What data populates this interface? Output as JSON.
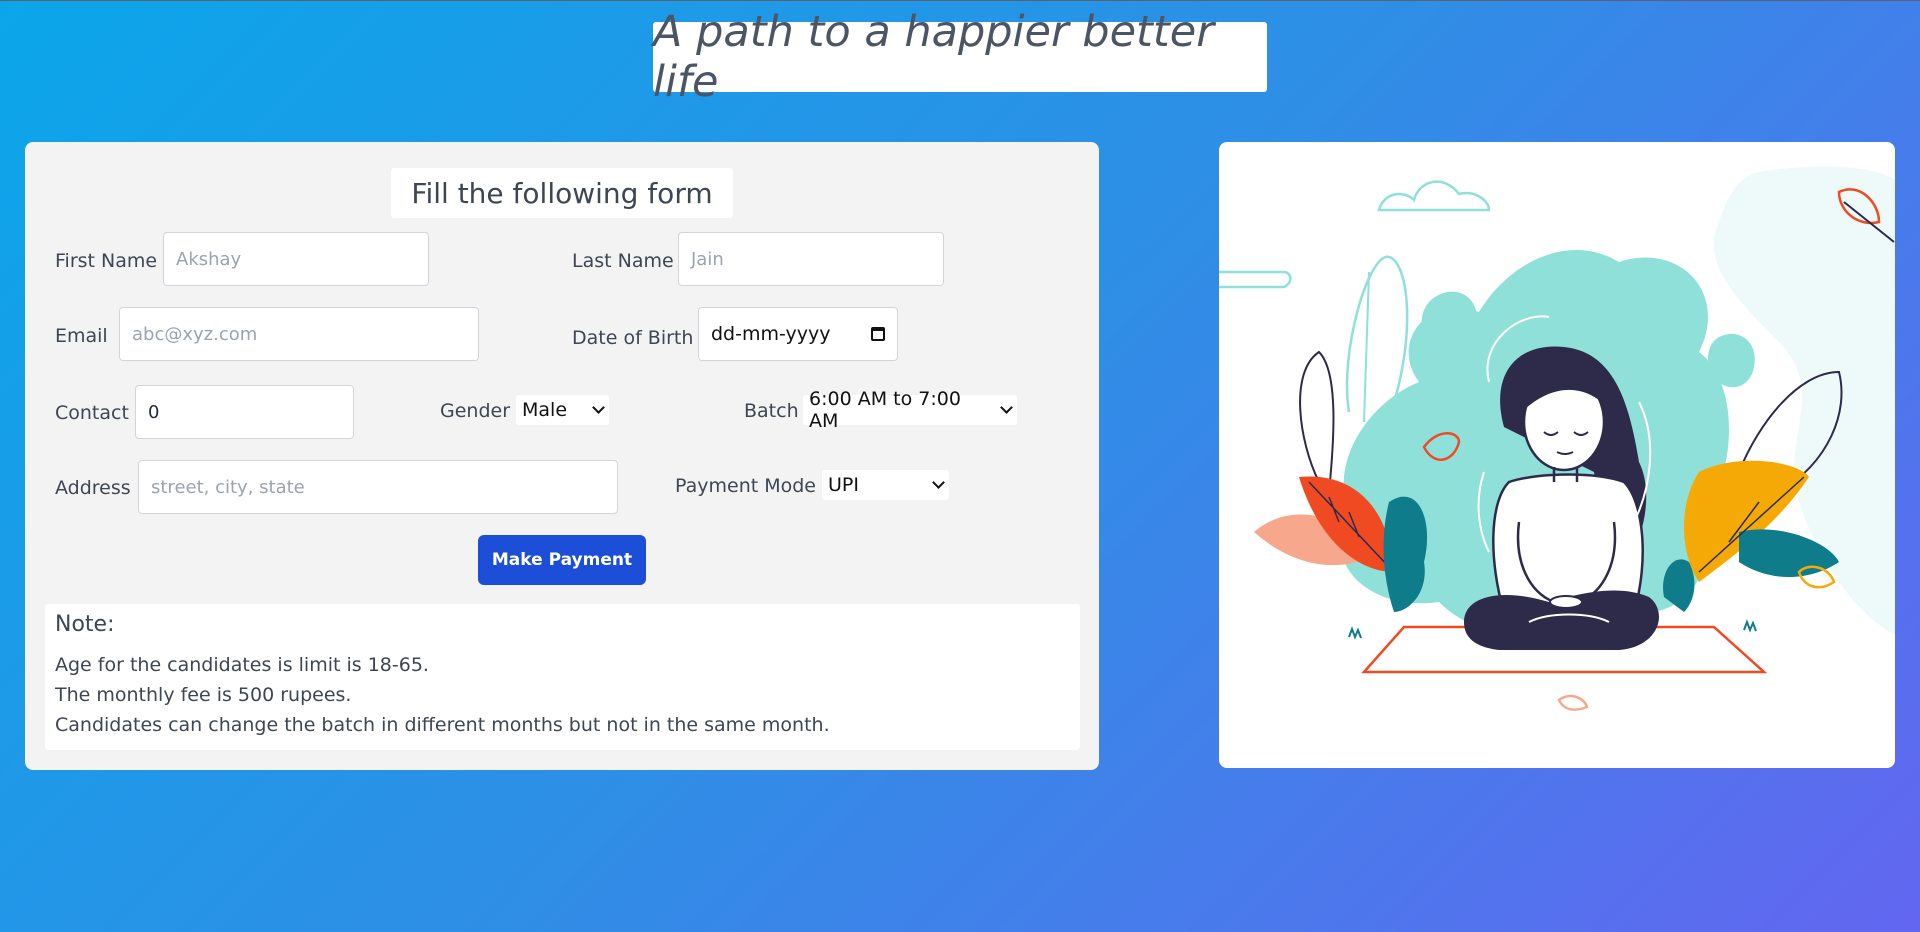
{
  "header": {
    "title": "A path to a happier better life"
  },
  "form": {
    "heading": "Fill the following form",
    "first_name": {
      "label": "First Name",
      "placeholder": "Akshay"
    },
    "last_name": {
      "label": "Last Name",
      "placeholder": "Jain"
    },
    "email": {
      "label": "Email",
      "placeholder": "abc@xyz.com"
    },
    "dob": {
      "label": "Date of Birth",
      "placeholder": "dd-mm-yyyy"
    },
    "contact": {
      "label": "Contact",
      "value": "0"
    },
    "gender": {
      "label": "Gender",
      "selected": "Male"
    },
    "batch": {
      "label": "Batch",
      "selected": "6:00 AM to 7:00 AM"
    },
    "address": {
      "label": "Address",
      "placeholder": "street, city, state"
    },
    "payment_mode": {
      "label": "Payment Mode",
      "selected": "UPI"
    },
    "submit_label": "Make Payment"
  },
  "note": {
    "title": "Note:",
    "lines": [
      "Age for the candidates is limit is 18-65.",
      "The monthly fee is 500 rupees.",
      "Candidates can change the batch in different months but not in the same month."
    ]
  },
  "illustration": {
    "name": "meditating-woman-illustration",
    "colors": {
      "blob": "#8fe0d9",
      "leaf_orange": "#f04a23",
      "leaf_yellow": "#f5a906",
      "leaf_teal": "#0f7c8c",
      "outline": "#2d2a4a"
    }
  }
}
